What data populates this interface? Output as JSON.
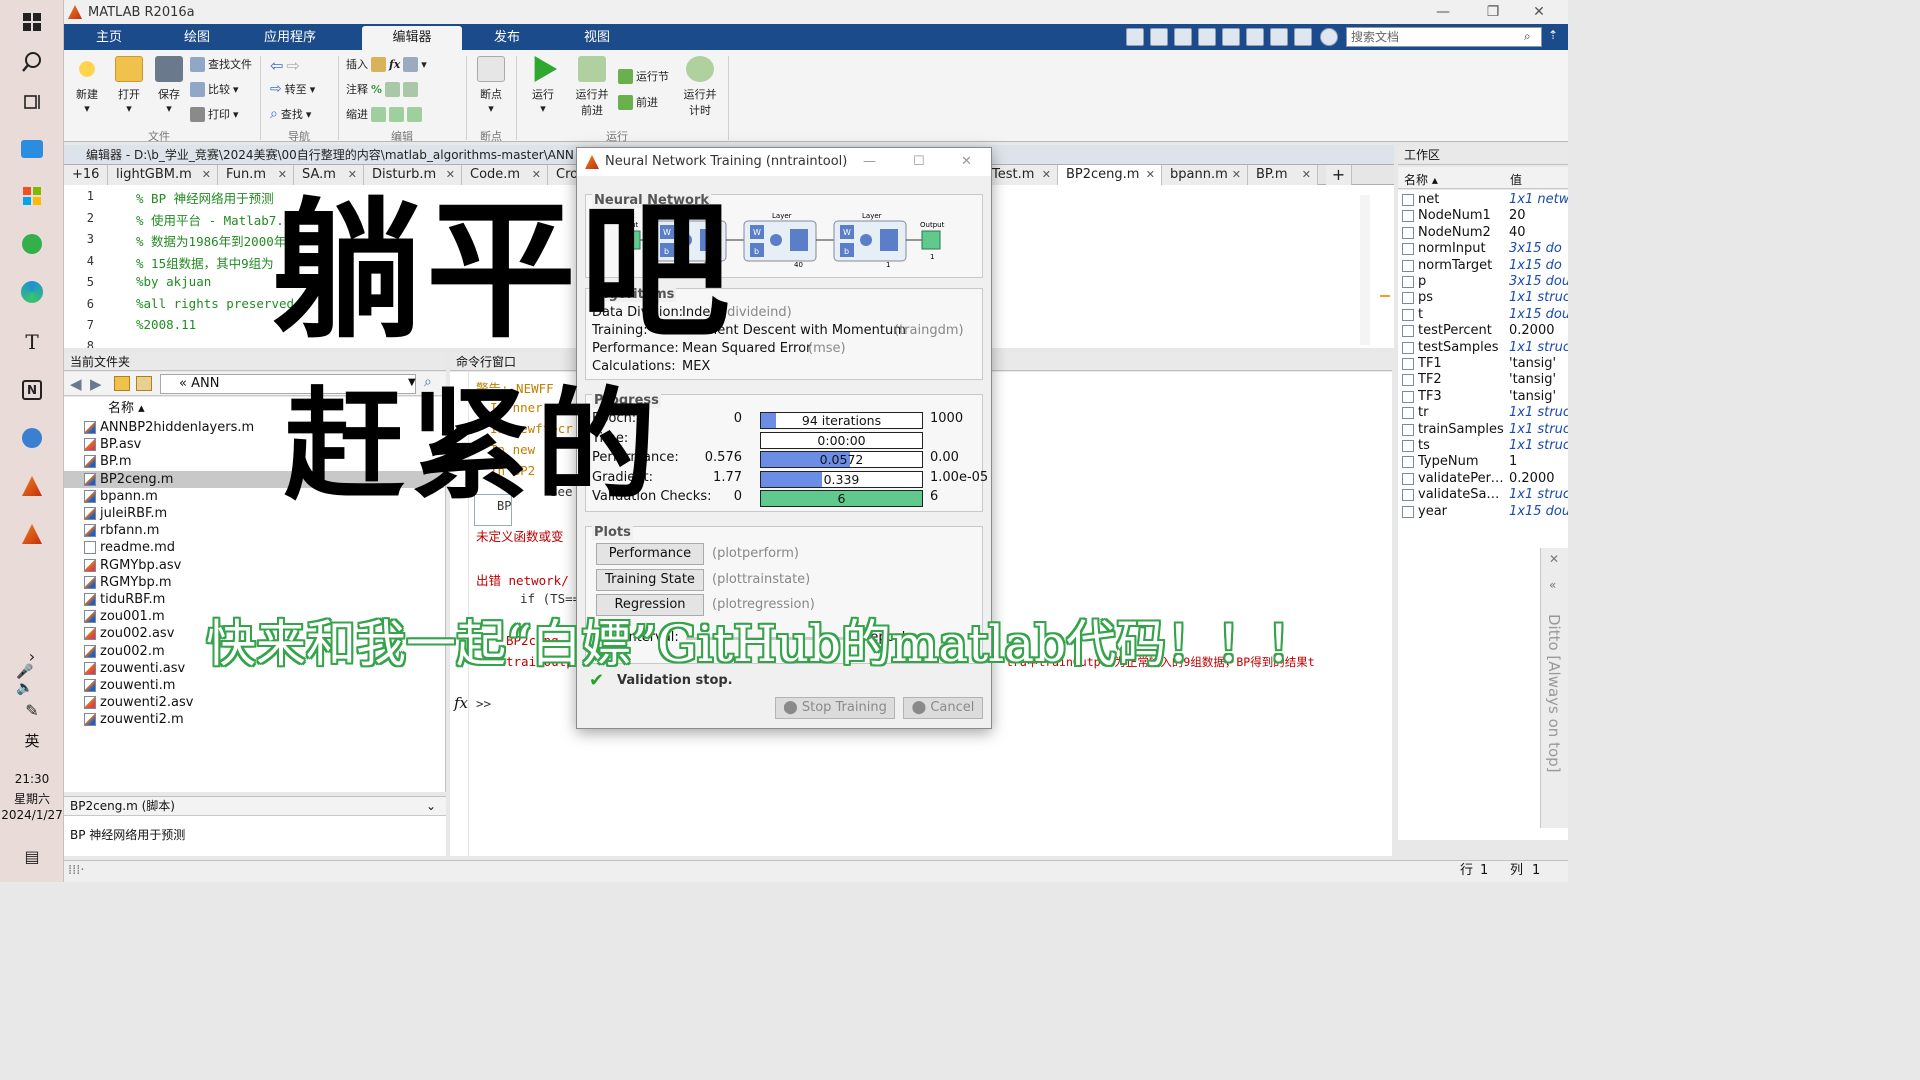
{
  "app": {
    "title": "MATLAB R2016a"
  },
  "taskbar": {
    "time": "21:30",
    "weekday": "星期六",
    "date": "2024/1/27",
    "ime": "英"
  },
  "ribbon": {
    "tabs": [
      "主页",
      "绘图",
      "应用程序",
      "编辑器",
      "发布",
      "视图"
    ],
    "active_tab": "编辑器",
    "search_placeholder": "搜索文档",
    "file": {
      "new": "新建",
      "open": "打开",
      "save": "保存",
      "find_files": "查找文件",
      "compare": "比较",
      "print": "打印",
      "group": "文件"
    },
    "nav": {
      "goto": "转至",
      "find": "查找",
      "group": "导航"
    },
    "edit": {
      "insert": "插入",
      "comment": "注释",
      "indent": "缩进",
      "fx": "fx",
      "group": "编辑"
    },
    "breakpoints": {
      "label": "断点",
      "group": "断点"
    },
    "run": {
      "run": "运行",
      "run_advance": "运行并\n前进",
      "run_section": "运行节",
      "advance": "前进",
      "run_time": "运行并\n计时",
      "group": "运行"
    }
  },
  "editor": {
    "title": "编辑器 - D:\\b_学业_竞赛\\2024美赛\\00自行整理的内容\\matlab_algorithms-master\\ANN",
    "tabs_more": "+16",
    "tabs": [
      "lightGBM.m",
      "Fun.m",
      "SA.m",
      "Disturb.m",
      "Code.m",
      "Cro",
      "Test.m",
      "BP2ceng.m",
      "bpann.m",
      "BP.m"
    ],
    "active_tab": "BP2ceng.m",
    "lines": [
      {
        "n": "1",
        "code": "% BP 神经网络用于预测"
      },
      {
        "n": "2",
        "code": "% 使用平台 - Matlab7.0"
      },
      {
        "n": "3",
        "code": "% 数据为1986年到2000年的"
      },
      {
        "n": "4",
        "code": "% 15组数据，其中9组为"
      },
      {
        "n": "5",
        "code": "%by akjuan"
      },
      {
        "n": "6",
        "code": "%all rights preserved"
      },
      {
        "n": "7",
        "code": "%2008.11"
      },
      {
        "n": "8",
        "code": ""
      }
    ]
  },
  "folder": {
    "title": "当前文件夹",
    "path": "« ANN",
    "col_name": "名称 ▴",
    "files": [
      "ANNBP2hiddenlayers.m",
      "BP.asv",
      "BP.m",
      "BP2ceng.m",
      "bpann.m",
      "juleiRBF.m",
      "rbfann.m",
      "readme.md",
      "RGMYbp.asv",
      "RGMYbp.m",
      "tiduRBF.m",
      "zou001.m",
      "zou002.asv",
      "zou002.m",
      "zouwenti.asv",
      "zouwenti.m",
      "zouwenti2.asv",
      "zouwenti2.m"
    ],
    "selected": "BP2ceng.m",
    "details_title": "BP2ceng.m  (脚本)",
    "details_text": "BP 神经网络用于预测"
  },
  "command": {
    "title": "命令行窗口",
    "lines": [
      {
        "text": "警告: NEWFF us",
        "color": "#c08000"
      },
      {
        "text": "In nnerr.",
        "color": "#c08000"
      },
      {
        "text": "In newff>cr",
        "color": "#c08000"
      },
      {
        "text": "In new",
        "color": "#c08000"
      },
      {
        "text": "In BP2",
        "color": "#c08000"
      },
      {
        "text": "See",
        "color": "#333333"
      },
      {
        "text": "未定义函数或变",
        "color": "#c00000"
      },
      {
        "text": "出错 network/",
        "color": "#c00000"
      },
      {
        "text": "if (TS==",
        "color": "#333333"
      },
      {
        "text": "BP2ceng",
        "color": "#c00000"
      },
      {
        "text": "trainOutp",
        "color": "#c00000"
      }
    ],
    "right_fragment": "tra中trainOutput为正常输入的9组数据，BP得到的结果t",
    "popup": "BP",
    "prompt": ">>"
  },
  "workspace": {
    "title": "工作区",
    "col_name": "名称 ▴",
    "col_value": "值",
    "vars": [
      {
        "name": "net",
        "value": "1x1 netw",
        "it": true
      },
      {
        "name": "NodeNum1",
        "value": "20",
        "it": false
      },
      {
        "name": "NodeNum2",
        "value": "40",
        "it": false
      },
      {
        "name": "normInput",
        "value": "3x15 do",
        "it": true
      },
      {
        "name": "normTarget",
        "value": "1x15 do",
        "it": true
      },
      {
        "name": "p",
        "value": "3x15 dou",
        "it": true
      },
      {
        "name": "ps",
        "value": "1x1 struc",
        "it": true
      },
      {
        "name": "t",
        "value": "1x15 dou",
        "it": true
      },
      {
        "name": "testPercent",
        "value": "0.2000",
        "it": false
      },
      {
        "name": "testSamples",
        "value": "1x1 struc",
        "it": true
      },
      {
        "name": "TF1",
        "value": "'tansig'",
        "it": false
      },
      {
        "name": "TF2",
        "value": "'tansig'",
        "it": false
      },
      {
        "name": "TF3",
        "value": "'tansig'",
        "it": false
      },
      {
        "name": "tr",
        "value": "1x1 struc",
        "it": true
      },
      {
        "name": "trainSamples",
        "value": "1x1 struc",
        "it": true
      },
      {
        "name": "ts",
        "value": "1x1 struc",
        "it": true
      },
      {
        "name": "TypeNum",
        "value": "1",
        "it": false
      },
      {
        "name": "validatePerc...",
        "value": "0.2000",
        "it": false
      },
      {
        "name": "validateSam...",
        "value": "1x1 struc",
        "it": true
      },
      {
        "name": "year",
        "value": "1x15 dou",
        "it": true
      }
    ],
    "ditto": "Ditto [Always on top]"
  },
  "status": {
    "row_label": "行",
    "row": "1",
    "col_label": "列",
    "col": "1"
  },
  "nntool": {
    "title": "Neural Network Training (nntraintool)",
    "network_header": "Neural Network",
    "diagram": {
      "input": "Input",
      "layer": "Layer",
      "output": "Output",
      "in_n": "3",
      "l1_n": "20",
      "l2_n": "40",
      "l3_n": "1",
      "out_n": "1",
      "w": "W",
      "b": "b"
    },
    "algorithms_header": "Algorithms",
    "algorithms": [
      {
        "k": "Data Division:",
        "v": "Index",
        "g": "(divideind)"
      },
      {
        "k": "Training:",
        "v": "Gradient Descent with Momentum",
        "g": "(traingdm)"
      },
      {
        "k": "Performance:",
        "v": "Mean Squared Error",
        "g": "(mse)"
      },
      {
        "k": "Calculations:",
        "v": "MEX",
        "g": ""
      }
    ],
    "progress_header": "Progress",
    "progress": [
      {
        "k": "Epoch:",
        "min": "0",
        "bar": "94 iterations",
        "max": "1000",
        "fill": 0.094,
        "color": "#6b8de6"
      },
      {
        "k": "Time:",
        "min": "",
        "bar": "0:00:00",
        "max": "",
        "fill": 0,
        "color": "#6b8de6"
      },
      {
        "k": "Performance:",
        "min": "0.576",
        "bar": "0.0572",
        "max": "0.00",
        "fill": 0.55,
        "color": "#6b8de6"
      },
      {
        "k": "Gradient:",
        "min": "1.77",
        "bar": "0.339",
        "max": "1.00e-05",
        "fill": 0.38,
        "color": "#6b8de6"
      },
      {
        "k": "Validation Checks:",
        "min": "0",
        "bar": "6",
        "max": "6",
        "fill": 1.0,
        "color": "#5fc98e"
      }
    ],
    "plots_header": "Plots",
    "plots": [
      {
        "label": "Performance",
        "fn": "(plotperform)"
      },
      {
        "label": "Training State",
        "fn": "(plottrainstate)"
      },
      {
        "label": "Regression",
        "fn": "(plotregression)"
      }
    ],
    "plot_interval_label": "Plot Interval:",
    "plot_interval_value": "1 epochs",
    "status_text": "Validation stop.",
    "stop_button": "Stop Training",
    "cancel_button": "Cancel"
  },
  "overlay": {
    "line1": "躺平吧",
    "line2": "赶紧的",
    "line3": "快来和我一起“白嫖”GitHub的matlab代码！！！"
  }
}
